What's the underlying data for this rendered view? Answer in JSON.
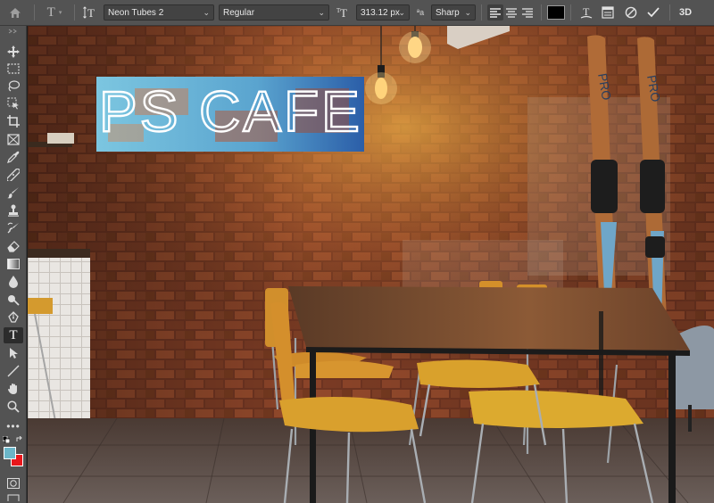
{
  "options_bar": {
    "font_family": "Neon Tubes 2",
    "font_style": "Regular",
    "font_size": "313.12 px",
    "aa_glyph": "ªa",
    "antialias": "Sharp",
    "text_color": "#000000",
    "label_3d": "3D"
  },
  "canvas": {
    "sign_text": "PS CAFE"
  },
  "colors": {
    "foreground": "#6bb6c8",
    "background": "#e8161b",
    "sign_panel": "#5aa4cf"
  },
  "icons": [
    "home-icon",
    "type-tool-icon",
    "text-orientation-icon",
    "font-size-icon",
    "align-left-icon",
    "align-center-icon",
    "align-right-icon",
    "warp-text-icon",
    "character-panel-icon",
    "cancel-icon",
    "commit-icon"
  ]
}
